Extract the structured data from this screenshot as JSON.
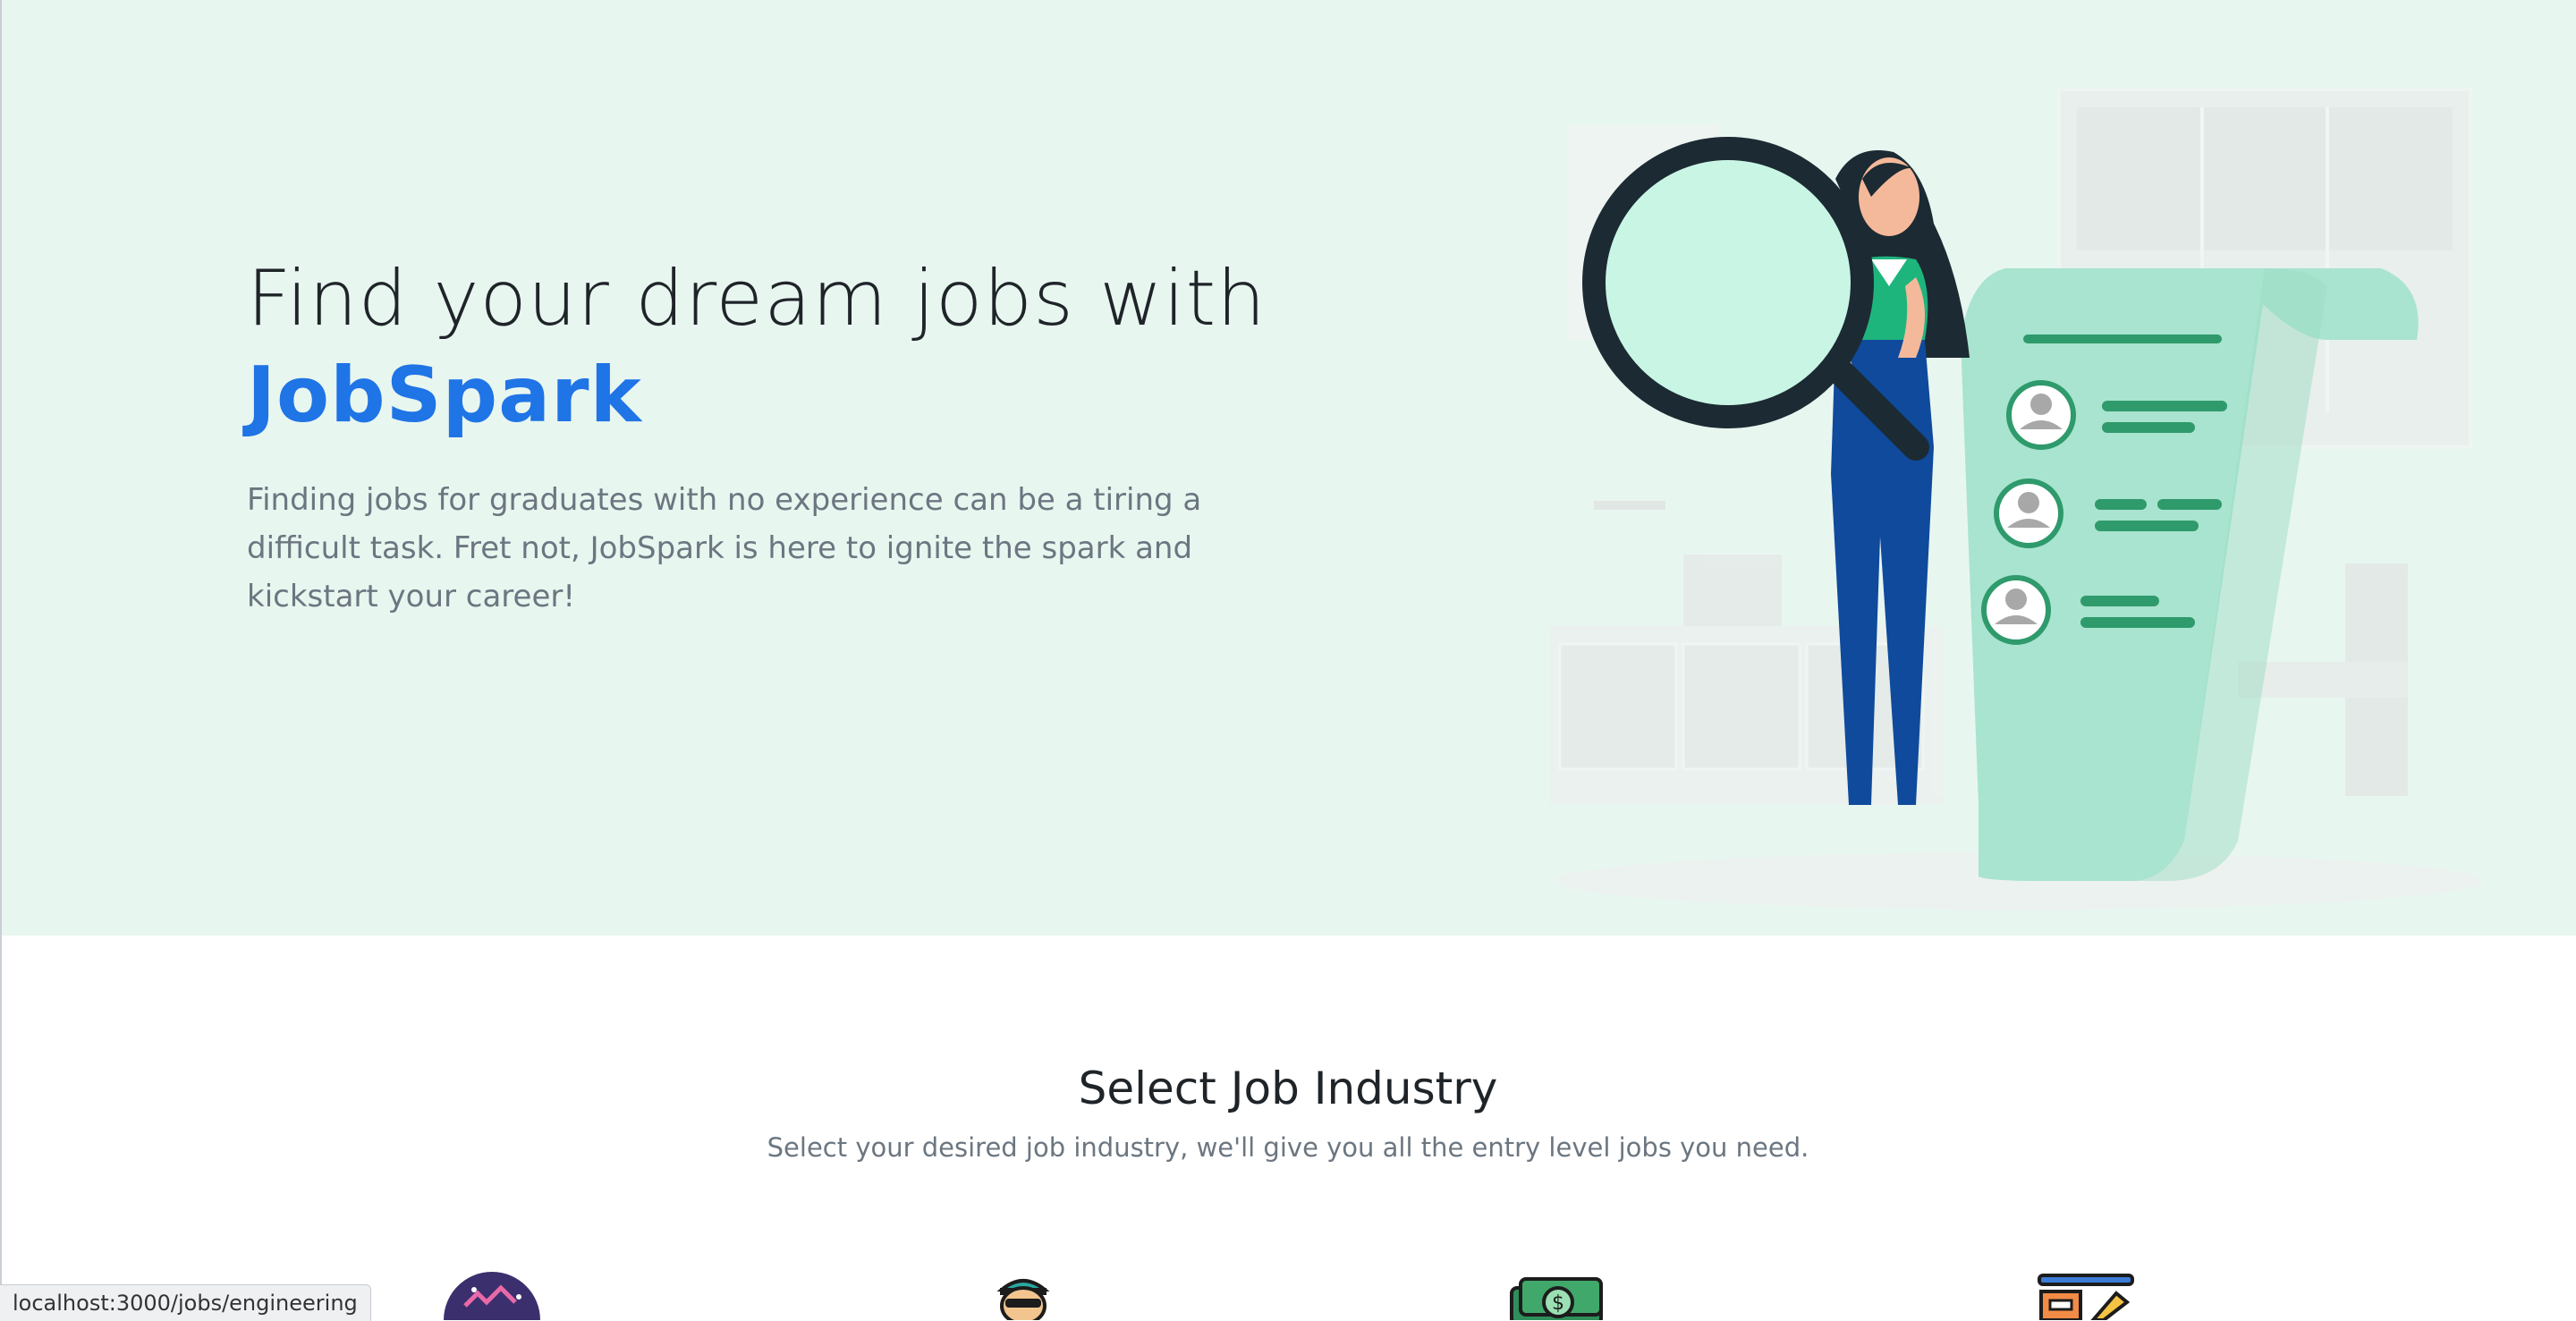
{
  "hero": {
    "title_line": "Find your dream jobs with",
    "brand": "JobSpark",
    "description": "Finding jobs for graduates with no experience can be a tiring a difficult task. Fret not, JobSpark is here to ignite the spark and kickstart your career!",
    "illustration": "woman-with-magnifying-glass-and-resume-list"
  },
  "industry": {
    "title": "Select Job Industry",
    "subtitle": "Select your desired job industry, we'll give you all the entry level jobs you need.",
    "icons": [
      "space-badge-icon",
      "person-with-cap-icon",
      "money-bills-icon",
      "drafting-tools-icon"
    ]
  },
  "status_bar": {
    "url": "localhost:3000/jobs/engineering"
  },
  "colors": {
    "hero_bg": "#e8f6f0",
    "brand": "#1f74e6",
    "accent_green": "#1eb57d",
    "paper_green": "#a8e4cf"
  }
}
